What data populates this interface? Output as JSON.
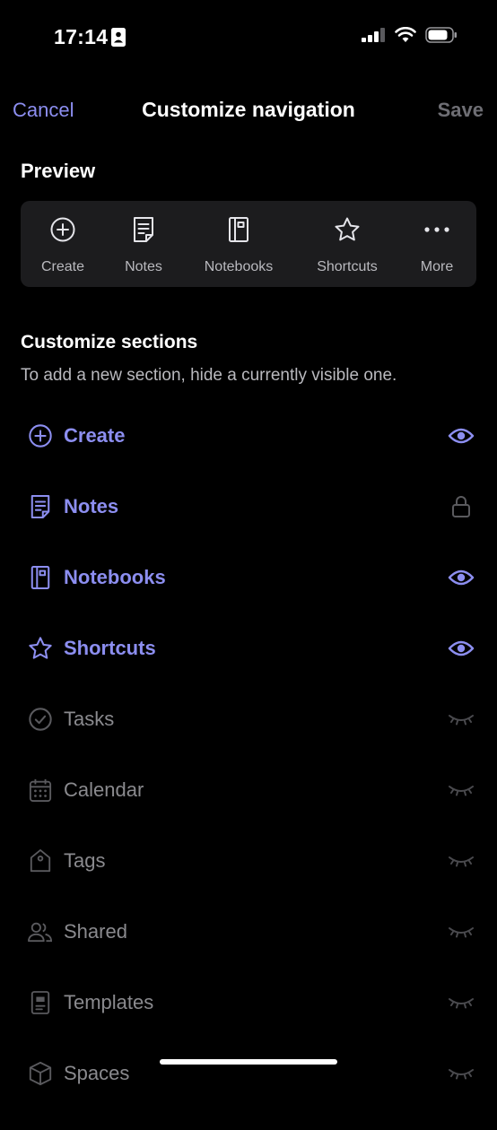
{
  "status_bar": {
    "time": "17:14"
  },
  "header": {
    "cancel_label": "Cancel",
    "title": "Customize navigation",
    "save_label": "Save"
  },
  "preview": {
    "heading": "Preview",
    "items": [
      {
        "label": "Create",
        "icon": "plus-circle-icon"
      },
      {
        "label": "Notes",
        "icon": "note-icon"
      },
      {
        "label": "Notebooks",
        "icon": "notebook-icon"
      },
      {
        "label": "Shortcuts",
        "icon": "star-icon"
      },
      {
        "label": "More",
        "icon": "more-icon"
      }
    ]
  },
  "sections": {
    "heading": "Customize sections",
    "description": "To add a new section, hide a currently visible one.",
    "items": [
      {
        "label": "Create",
        "icon": "plus-circle-icon",
        "state": "visible"
      },
      {
        "label": "Notes",
        "icon": "note-icon",
        "state": "locked"
      },
      {
        "label": "Notebooks",
        "icon": "notebook-icon",
        "state": "visible"
      },
      {
        "label": "Shortcuts",
        "icon": "star-icon",
        "state": "visible"
      },
      {
        "label": "Tasks",
        "icon": "check-circle-icon",
        "state": "hidden"
      },
      {
        "label": "Calendar",
        "icon": "calendar-icon",
        "state": "hidden"
      },
      {
        "label": "Tags",
        "icon": "tag-icon",
        "state": "hidden"
      },
      {
        "label": "Shared",
        "icon": "people-icon",
        "state": "hidden"
      },
      {
        "label": "Templates",
        "icon": "template-icon",
        "state": "hidden"
      },
      {
        "label": "Spaces",
        "icon": "cube-icon",
        "state": "hidden"
      }
    ]
  },
  "colors": {
    "accent": "#8c8ef0",
    "muted": "#8a8a8e",
    "background": "#000000",
    "surface": "#1c1c1e"
  }
}
